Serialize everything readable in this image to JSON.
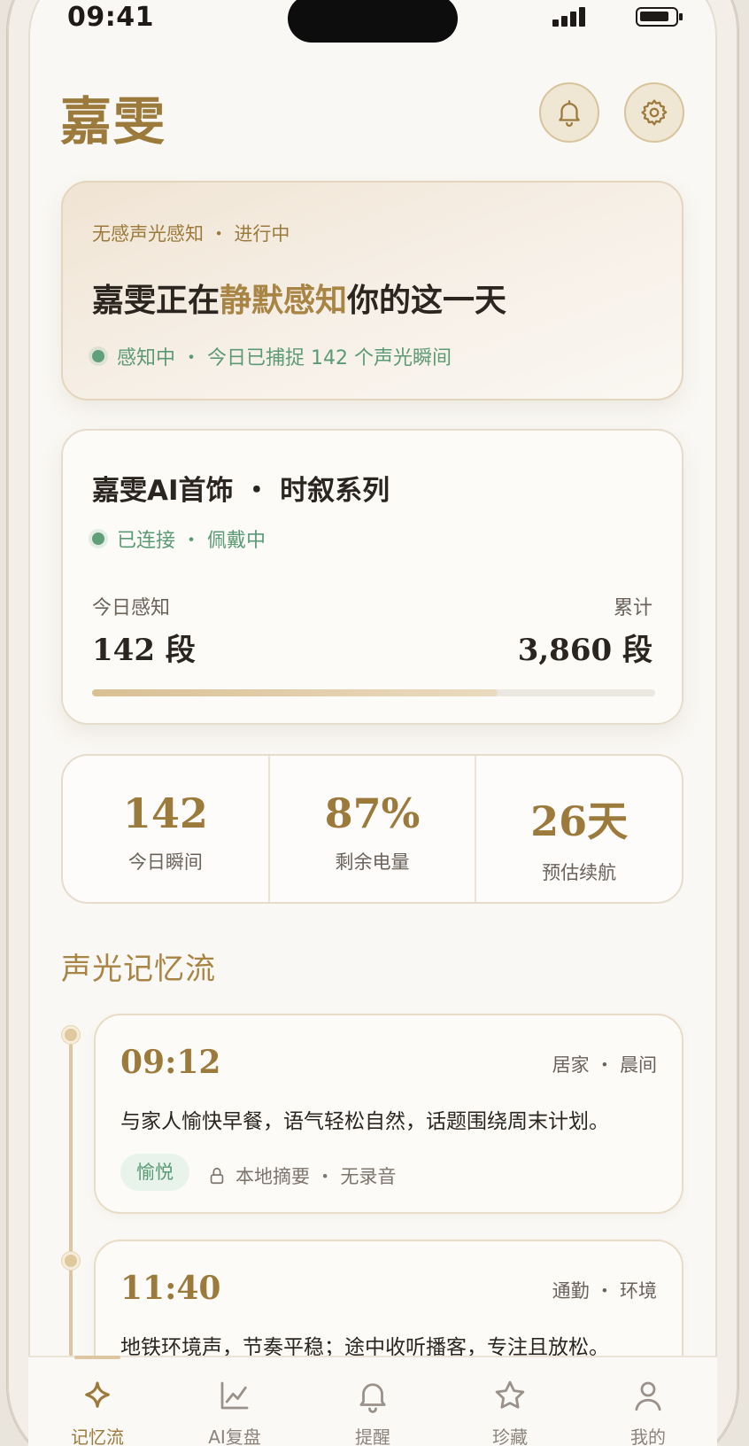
{
  "status_bar": {
    "time": "09:41"
  },
  "header": {
    "brand": "嘉雯"
  },
  "hero": {
    "kicker": "无感声光感知 ・ 进行中",
    "title_pre": "嘉雯正在",
    "title_highlight": "静默感知",
    "title_post": "你的这一天",
    "status": "感知中 ・ 今日已捕捉 142 个声光瞬间"
  },
  "device": {
    "title": "嘉雯AI首饰 ・ 时叙系列",
    "status": "已连接 ・ 佩戴中",
    "today_label": "今日感知",
    "today_value": "142 段",
    "total_label": "累计",
    "total_value": "3,860 段",
    "progress_fraction": 0.72
  },
  "metrics": [
    {
      "value": "142",
      "label": "今日瞬间"
    },
    {
      "value": "87%",
      "label": "剩余电量"
    },
    {
      "value": "26天",
      "label": "预估续航"
    }
  ],
  "section": {
    "title": "声光记忆流"
  },
  "entries": [
    {
      "time": "09:12",
      "meta": "居家 ・ 晨间",
      "text": "与家人愉快早餐，语气轻松自然，话题围绕周末计划。",
      "tag": "愉悦",
      "privacy": "本地摘要 ・ 无录音"
    },
    {
      "time": "11:40",
      "meta": "通勤 ・ 环境",
      "text": "地铁环境声，节奏平稳；途中收听播客，专注且放松。"
    }
  ],
  "tabs": [
    {
      "label": "记忆流",
      "icon": "sparkle-icon",
      "active": true
    },
    {
      "label": "AI复盘",
      "icon": "chart-icon"
    },
    {
      "label": "提醒",
      "icon": "bell-icon"
    },
    {
      "label": "珍藏",
      "icon": "star-icon"
    },
    {
      "label": "我的",
      "icon": "person-icon"
    }
  ],
  "colors": {
    "accent_gold": "#9c7a3c",
    "status_green": "#5a9a74",
    "background": "#faf8f4"
  }
}
